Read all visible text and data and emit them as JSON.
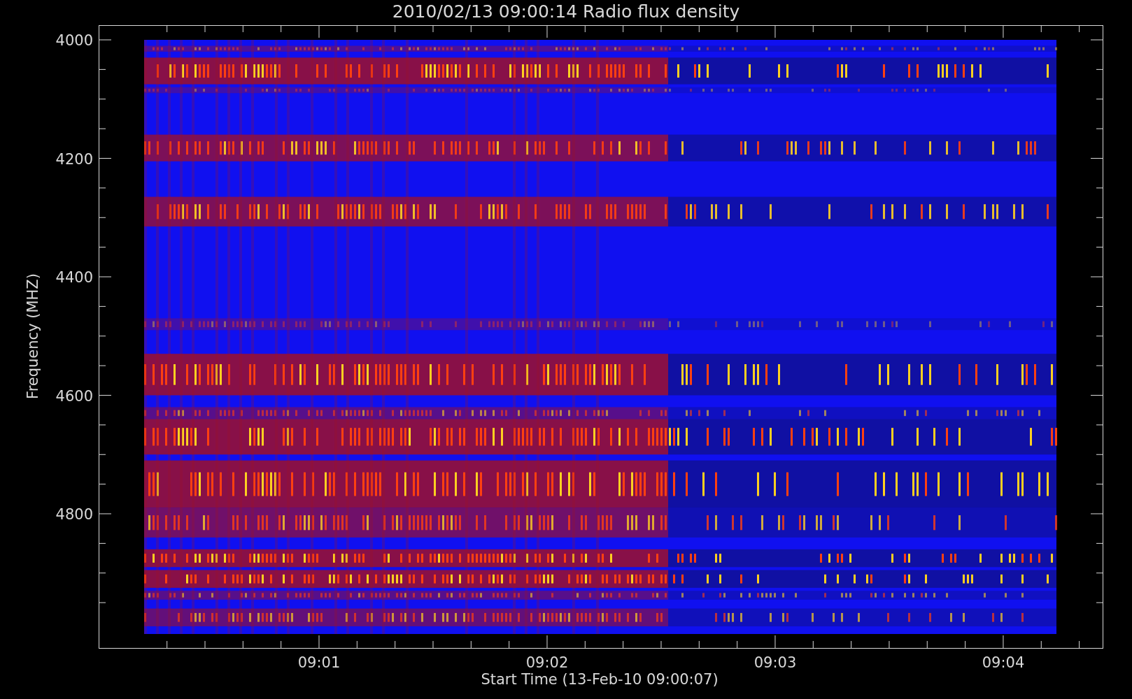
{
  "title": "2010/02/13 09:00:14 Radio flux density",
  "y_axis": {
    "label": "Frequency (MHZ)",
    "ticks": [
      "4000",
      "4200",
      "4400",
      "4600",
      "4800"
    ]
  },
  "x_axis": {
    "label": "Start Time (13-Feb-10 09:00:07)",
    "ticks": [
      "09:01",
      "09:02",
      "09:03",
      "09:04"
    ]
  }
}
